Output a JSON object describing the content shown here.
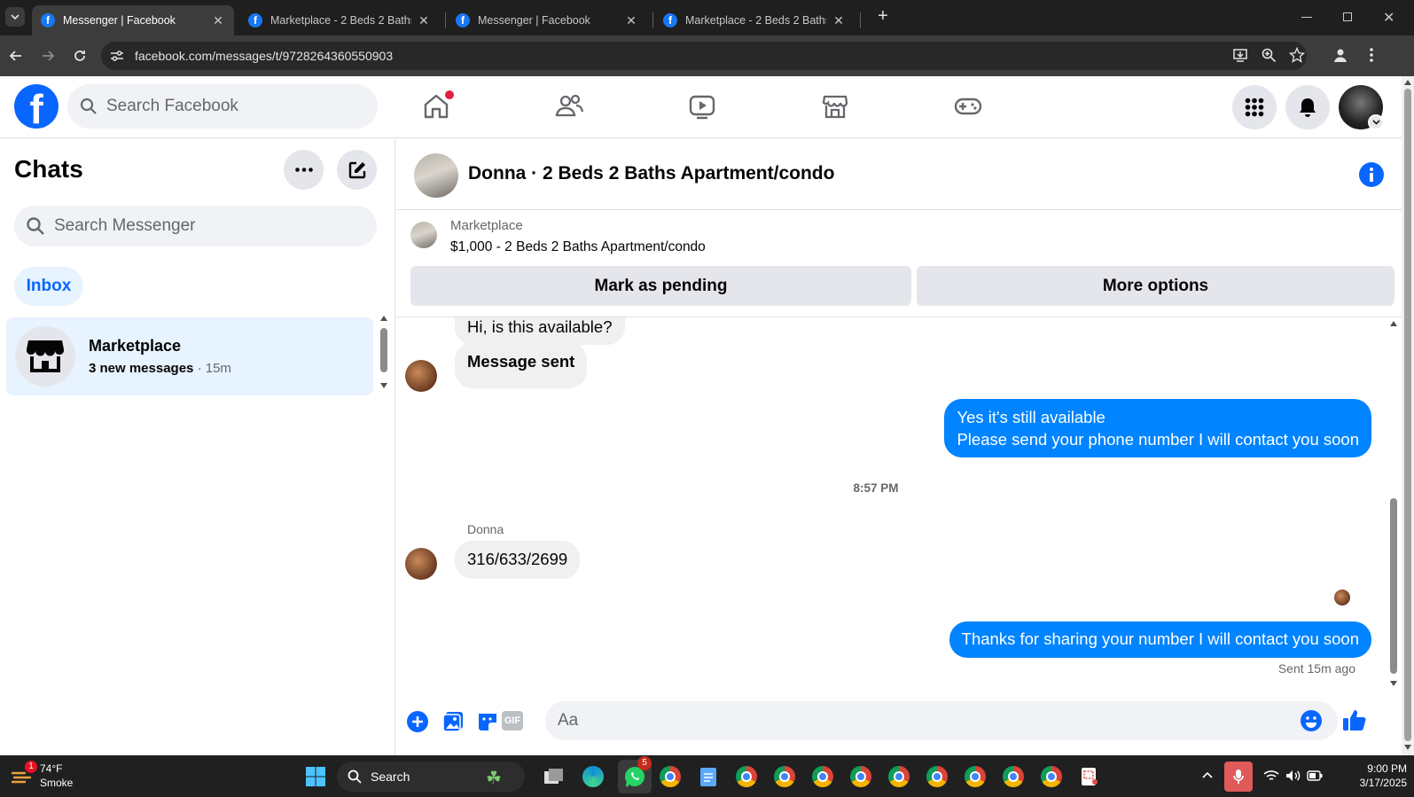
{
  "browser": {
    "tabs": [
      {
        "title": "Messenger | Facebook",
        "active": true
      },
      {
        "title": "Marketplace - 2 Beds 2 Baths Ap",
        "active": false
      },
      {
        "title": "Messenger | Facebook",
        "active": false
      },
      {
        "title": "Marketplace - 2 Beds 2 Baths Ap",
        "active": false
      }
    ],
    "close_glyph": "✕",
    "new_tab_glyph": "+",
    "url": "facebook.com/messages/t/9728264360550903"
  },
  "fb_header": {
    "logo_letter": "f",
    "search_placeholder": "Search Facebook",
    "home_notification_color": "#e41e3f"
  },
  "sidebar": {
    "title": "Chats",
    "search_placeholder": "Search Messenger",
    "filter_label": "Inbox",
    "conversations": [
      {
        "name": "Marketplace",
        "preview": "3 new messages",
        "time": "· 15m"
      }
    ]
  },
  "conversation": {
    "title": "Donna · 2 Beds 2 Baths Apartment/condo",
    "banner": {
      "label": "Marketplace",
      "listing": "$1,000 - 2 Beds 2 Baths Apartment/condo",
      "primary_button": "Mark as pending",
      "secondary_button": "More options"
    },
    "messages": [
      {
        "from": "them",
        "text": "Hi, is this available?"
      },
      {
        "from": "them",
        "text": "Message sent",
        "bold": true
      },
      {
        "from": "me",
        "lines": [
          "Yes it's still available",
          "Please send your phone number I will contact you soon"
        ]
      },
      {
        "type": "timestamp",
        "text": "8:57 PM"
      },
      {
        "from": "them",
        "sender_name": "Donna",
        "text": "316/633/2699"
      },
      {
        "from": "me",
        "text": "Thanks for sharing your number I will contact you soon",
        "status": "Sent 15m ago"
      }
    ],
    "composer_placeholder": "Aa",
    "accent_color": "#0084ff"
  },
  "taskbar": {
    "weather_temp": "74°F",
    "weather_desc": "Smoke",
    "weather_badge": "1",
    "search_label": "Search",
    "whatsapp_badge": "5",
    "time": "9:00 PM",
    "date": "3/17/2025"
  }
}
